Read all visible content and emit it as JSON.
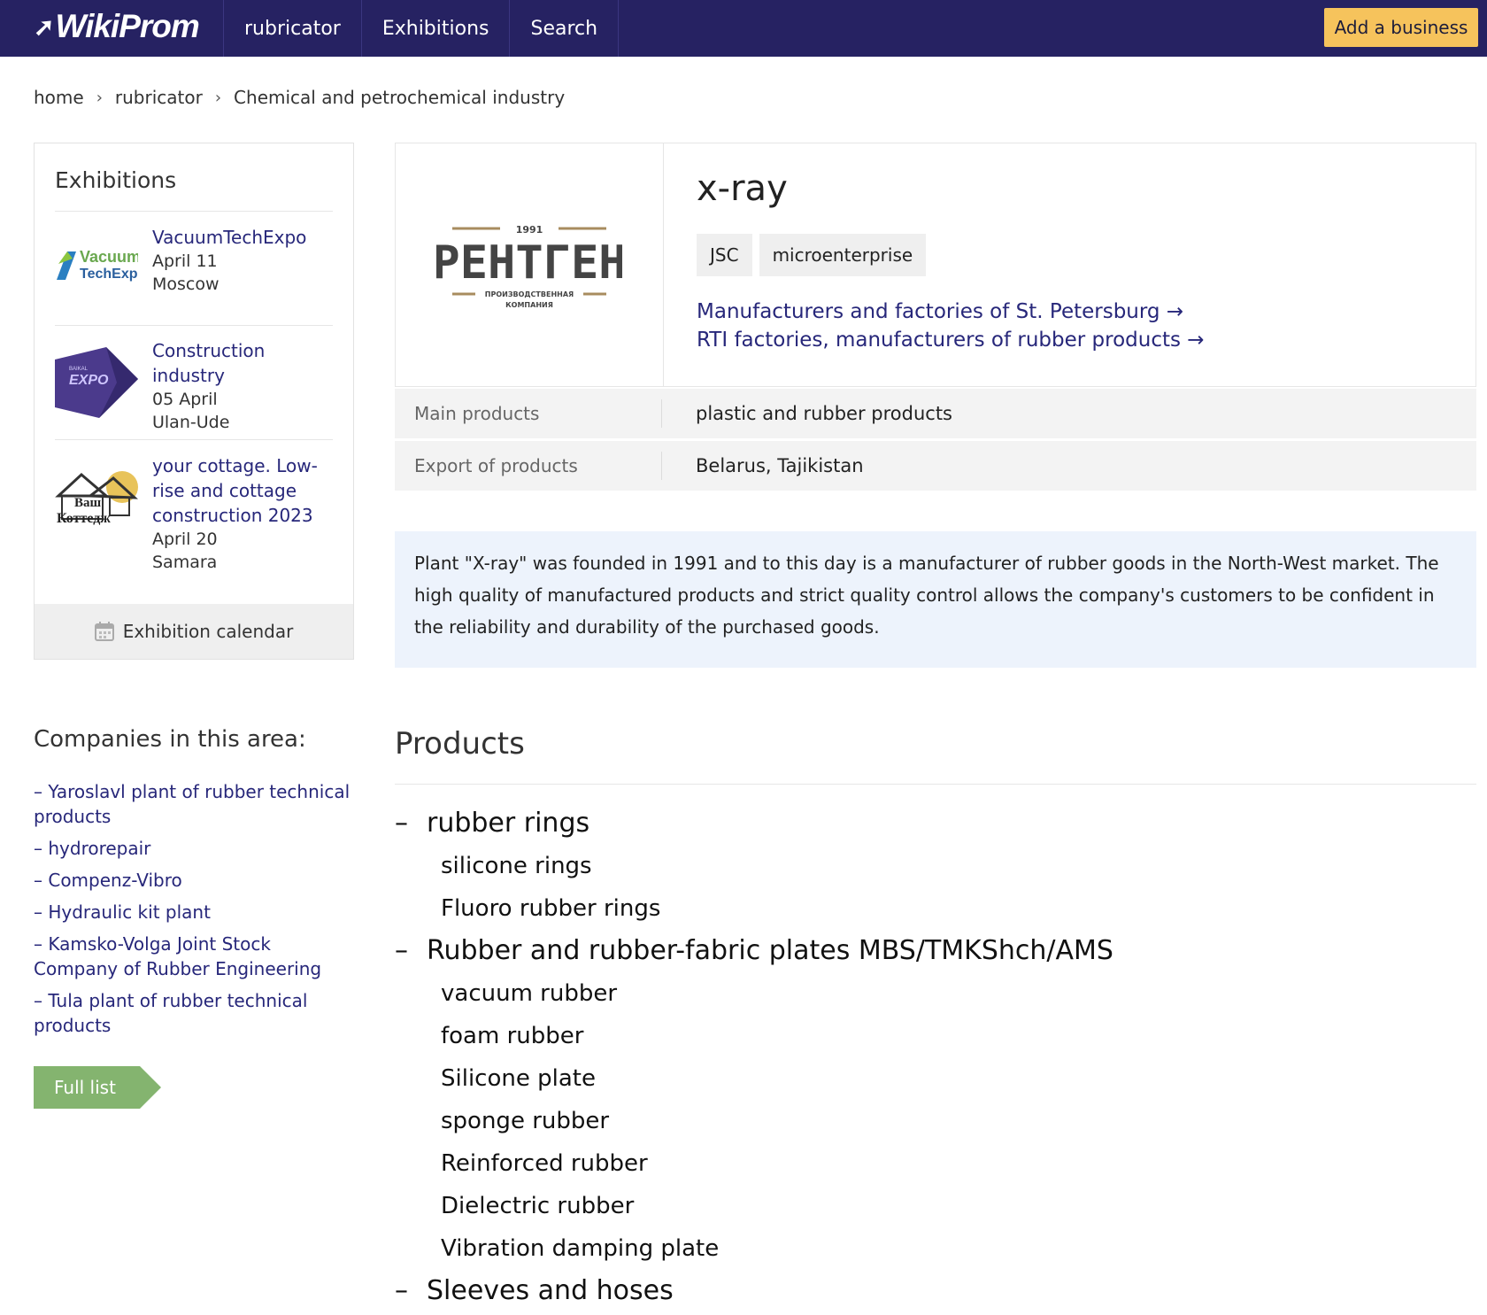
{
  "header": {
    "logo": "WikiProm",
    "nav": [
      "rubricator",
      "Exhibitions",
      "Search"
    ],
    "add_business": "Add a business"
  },
  "breadcrumb": [
    "home",
    "rubricator",
    "Chemical and petrochemical industry"
  ],
  "exhibitions": {
    "title": "Exhibitions",
    "items": [
      {
        "name": "VacuumTechExpo",
        "date": "April 11",
        "city": "Moscow",
        "logo_text": [
          "Vacuum",
          "TechExpo"
        ]
      },
      {
        "name": "Construction industry",
        "date": "05 April",
        "city": "Ulan-Ude",
        "logo_text": [
          "BAIKAL",
          "EXPO"
        ]
      },
      {
        "name": "your cottage. Low-rise and cottage construction 2023",
        "date": "April 20",
        "city": "Samara",
        "logo_text": [
          "Ваш",
          "Коттедж"
        ]
      }
    ],
    "calendar": "Exhibition calendar"
  },
  "companies": {
    "title": "Companies in this area:",
    "items": [
      "– Yaroslavl plant of rubber technical products",
      "– hydrorepair",
      "– Compenz-Vibro",
      "– Hydraulic kit plant",
      "– Kamsko-Volga Joint Stock Company of Rubber Engineering",
      "– Tula plant of rubber technical products"
    ],
    "full_list": "Full list"
  },
  "company": {
    "name": "x-ray",
    "logo": {
      "year": "1991",
      "name": "РЕНТГЕН",
      "sub1": "ПРОИЗВОДСТВЕННАЯ",
      "sub2": "КОМПАНИЯ"
    },
    "tags": [
      "JSC",
      "microenterprise"
    ],
    "links": [
      "Manufacturers and factories of St. Petersburg →",
      "RTI factories, manufacturers of rubber products →"
    ],
    "main_products_label": "Main products",
    "main_products": "plastic and rubber products",
    "export_label": "Export of products",
    "export": "Belarus, Tajikistan",
    "description": "Plant \"X-ray\" was founded in 1991 and to this day is a manufacturer of rubber goods in the North-West market. The high quality of manufactured products and strict quality control allows the company's customers to be confident in the reliability and durability of the purchased goods."
  },
  "products": {
    "title": "Products",
    "categories": [
      {
        "name": "rubber rings",
        "items": [
          "silicone rings",
          "Fluoro rubber rings"
        ]
      },
      {
        "name": "Rubber and rubber-fabric plates MBS/TMKShch/AMS",
        "items": [
          "vacuum rubber",
          "foam rubber",
          "Silicone plate",
          "sponge rubber",
          "Reinforced rubber",
          "Dielectric rubber",
          "Vibration damping plate"
        ]
      },
      {
        "name": "Sleeves and hoses",
        "items": []
      }
    ]
  },
  "colors": {
    "header_bg": "#262262",
    "accent_button": "#f6c35c",
    "link": "#27277a",
    "full_list_bg": "#84b46f",
    "description_bg": "#edf3fc"
  }
}
